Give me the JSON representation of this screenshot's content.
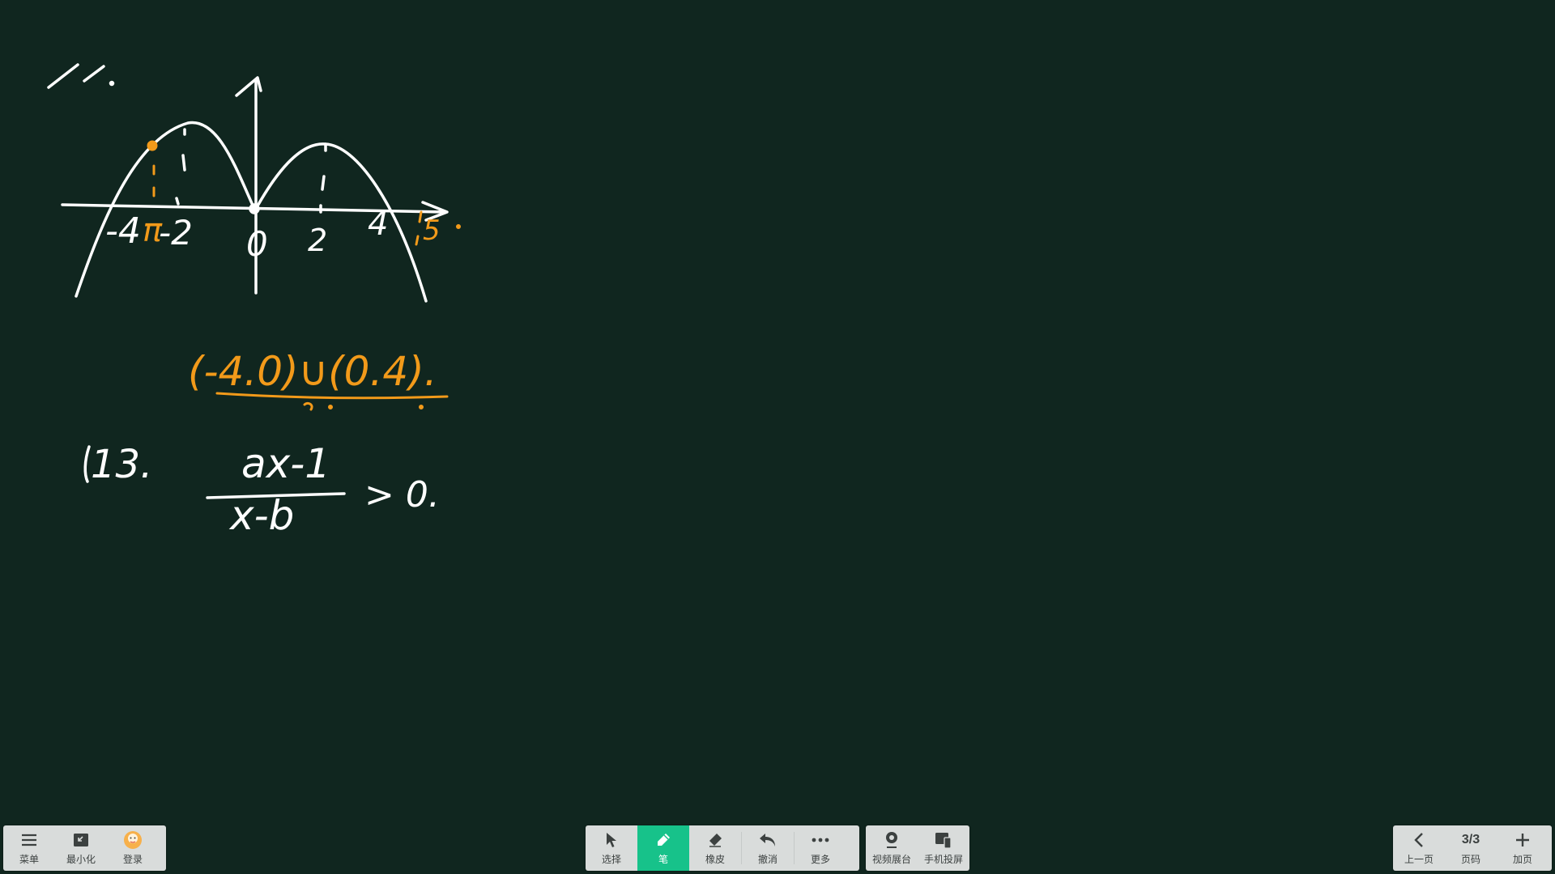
{
  "board": {
    "problem_11_label": "11.",
    "axis_labels": {
      "neg4": "-4",
      "neg_pi": "π",
      "neg2": "-2",
      "zero": "0",
      "two": "2",
      "four": "4",
      "five": "5"
    },
    "answer": "(-4.0)∪(0.4).",
    "problem_13_label": "13.",
    "numerator": "ax-1",
    "denominator": "x-b",
    "inequality": "> 0.",
    "ink_colors": {
      "white": "#ffffff",
      "orange": "#f29a1a"
    }
  },
  "toolbar": {
    "left": [
      {
        "label": "菜单",
        "icon": "menu-icon"
      },
      {
        "label": "最小化",
        "icon": "minimize-icon"
      },
      {
        "label": "登录",
        "icon": "avatar-icon"
      }
    ],
    "tools": [
      {
        "label": "选择",
        "icon": "cursor-icon",
        "active": false
      },
      {
        "label": "笔",
        "icon": "pen-icon",
        "active": true
      },
      {
        "label": "橡皮",
        "icon": "eraser-icon",
        "active": false
      },
      {
        "label": "撤消",
        "icon": "undo-icon",
        "active": false
      },
      {
        "label": "更多",
        "icon": "more-icon",
        "active": false
      }
    ],
    "extras": [
      {
        "label": "视频展台",
        "icon": "camera-icon"
      },
      {
        "label": "手机投屏",
        "icon": "phone-cast-icon"
      }
    ],
    "pager": {
      "prev_label": "上一页",
      "page": "3/3",
      "page_label": "页码",
      "add_label": "加页"
    },
    "accent_color": "#17c28a"
  }
}
